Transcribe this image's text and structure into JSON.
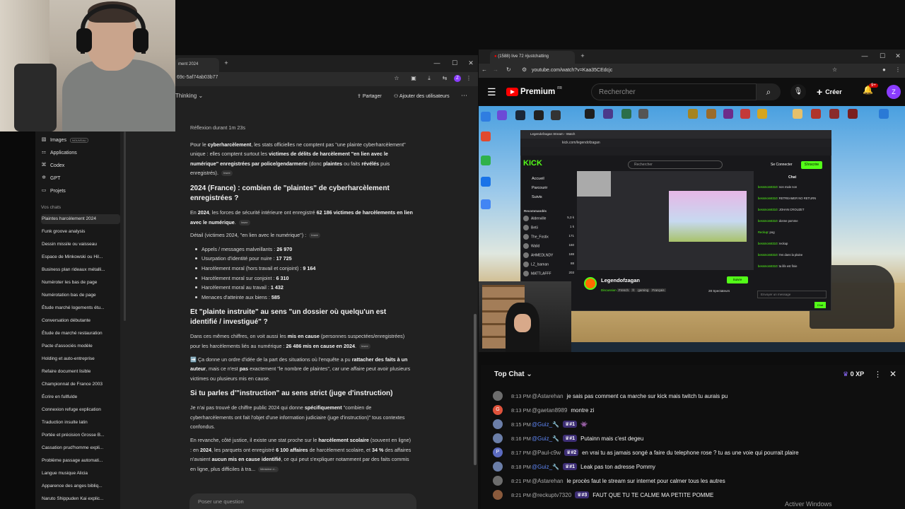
{
  "left_browser": {
    "tab_title": "ment 2024",
    "url": "69c-5af74ab03b77",
    "model_label": "Thinking",
    "share_label": "Partager",
    "add_users_label": "Ajouter des utilisateurs",
    "composer_placeholder": "Poser une question"
  },
  "sidebar": {
    "nav": [
      {
        "label": "Images",
        "badge": "NOUVEAU",
        "icon": "image-icon"
      },
      {
        "label": "Applications",
        "icon": "apps-icon"
      },
      {
        "label": "Codex",
        "icon": "code-icon"
      },
      {
        "label": "GPT",
        "icon": "gpt-icon"
      },
      {
        "label": "Projets",
        "icon": "folder-icon"
      }
    ],
    "chats_title": "Vos chats",
    "chats": [
      "Plaintes harcèlement 2024",
      "Funk groove analysis",
      "Dessin missile ou vaisseau",
      "Espace de Minkowski ou Hil...",
      "Business plan rideaux métalli...",
      "Numéroter les bas de page",
      "Numérotation bas de page",
      "Étude marché logements étu...",
      "Conversation débutante",
      "Étude de marché restauration",
      "Pacte d'associés modèle",
      "Holding et auto-entreprise",
      "Refaire document lisible",
      "Championnat de France 2003",
      "Écrire en fullfulde",
      "Connexion refuge explication",
      "Traduction insulte latin",
      "Portée et précision Grosse B...",
      "Cassation prud'homme expli...",
      "Problème passage automati...",
      "Langue musique Alicia",
      "Apparence des anges bibliq...",
      "Naruto Shippuden Kai explic..."
    ]
  },
  "answer": {
    "reflexion": "Réflexion durant 1m 23s",
    "src_label": "Insee",
    "src_label2": "Ministère d...",
    "p1_a": "Pour le ",
    "p1_b": "cyberharcèlement",
    "p1_c": ", les stats officielles ne comptent pas \"une plainte cyberharcèlement\" unique : elles comptent surtout les ",
    "p1_d": "victimes de délits de harcèlement \"en lien avec le numérique\" enregistrées par police/gendarmerie",
    "p1_e": " (donc ",
    "p1_f": "plaintes",
    "p1_g": " ou faits ",
    "p1_h": "révélés",
    "p1_i": " puis enregistrés).",
    "h1": "2024 (France) : combien de \"plaintes\" de cyberharcèlement enregistrées ?",
    "p2_a": "En ",
    "p2_b": "2024",
    "p2_c": ", les forces de sécurité intérieure ont enregistré ",
    "p2_d": "62 186 victimes de harcèlements en lien avec le numérique",
    "p2_e": ".",
    "detail_label": "Détail (victimes 2024, \"en lien avec le numérique\") :",
    "list": [
      {
        "label": "Appels / messages malveillants : ",
        "value": "26 970"
      },
      {
        "label": "Usurpation d'identité pour nuire : ",
        "value": "17 725"
      },
      {
        "label": "Harcèlement moral (hors travail et conjoint) : ",
        "value": "9 164"
      },
      {
        "label": "Harcèlement moral sur conjoint : ",
        "value": "6 310"
      },
      {
        "label": "Harcèlement moral au travail : ",
        "value": "1 432"
      },
      {
        "label": "Menaces d'atteinte aux biens : ",
        "value": "585"
      }
    ],
    "h2": "Et \"plainte instruite\" au sens \"un dossier où quelqu'un est identifié / investigué\" ?",
    "p3_a": "Dans ces mêmes chiffres, on voit aussi les ",
    "p3_b": "mis en cause",
    "p3_c": " (personnes suspectées/enregistrées) pour les harcèlements liés au numérique : ",
    "p3_d": "26 486 mis en cause en 2024",
    "p3_e": ".",
    "p4_a": "➡️ Ça donne un ordre d'idée de la part des situations où l'enquête a pu ",
    "p4_b": "rattacher des faits à un auteur",
    "p4_c": ", mais ce n'est ",
    "p4_d": "pas",
    "p4_e": " exactement \"le nombre de plaintes\", car une affaire peut avoir plusieurs victimes ou plusieurs mis en cause.",
    "h3": "Si tu parles d'\"instruction\" au sens strict (juge d'instruction)",
    "p5_a": "Je n'ai pas trouvé de chiffre public 2024 qui donne ",
    "p5_b": "spécifiquement",
    "p5_c": " \"combien de cyberharcèlements ont fait l'objet d'une information judiciaire (juge d'instruction)\" tous contextes confondus.",
    "p6_a": "En revanche, côté justice, il existe une stat proche sur le ",
    "p6_b": "harcèlement scolaire",
    "p6_c": " (souvent en ligne) : en ",
    "p6_d": "2024",
    "p6_e": ", les parquets ont enregistré ",
    "p6_f": "6 100 affaires",
    "p6_g": " de harcèlement scolaire, et ",
    "p6_h": "34 %",
    "p6_i": " des affaires n'avaient ",
    "p6_j": "aucun mis en cause identifié",
    "p6_k": ", ce qui peut s'expliquer notamment par des faits commis en ligne, plus difficiles à tra..."
  },
  "right_browser": {
    "tab_title": "(1588) live 72 #justchatting",
    "url": "youtube.com/watch?v=Kaa35CEdcjc"
  },
  "youtube": {
    "logo": "Premium",
    "region": "FR",
    "search_placeholder": "Rechercher",
    "create_label": "Créer",
    "notif_count": "9+",
    "avatar_letter": "Z"
  },
  "kick": {
    "tab_title": "Legendofzagan Stream - Watch",
    "url": "kick.com/legendofzagan",
    "logo": "KICK",
    "search_placeholder": "Rechercher",
    "connect": "Se Connecter",
    "signup": "S'inscrire",
    "nav": [
      "Accueil",
      "Parcourir",
      "Suivis"
    ],
    "reco_title": "Recommandés",
    "channels": [
      {
        "name": "Aldenville",
        "sub": "Fortnite",
        "v": "5,3 k"
      },
      {
        "name": "Betii",
        "sub": "Discussion",
        "v": "1 k"
      },
      {
        "name": "The_Fostix",
        "sub": "Grand Theft Auto V RP",
        "v": "171"
      },
      {
        "name": "Walid",
        "sub": "Discussion",
        "v": "160"
      },
      {
        "name": "AHMEDLNDY",
        "sub": "Discussion",
        "v": "188"
      },
      {
        "name": "LZ_Isaman",
        "sub": "Grand Theft Auto V RP",
        "v": "88"
      },
      {
        "name": "MATTLAFFF",
        "sub": "",
        "v": "203"
      }
    ],
    "chat_title": "Chat",
    "msgs": [
      {
        "u": "bessmom8310",
        "t": "non male non"
      },
      {
        "u": "bessmom8310",
        "t": "RETREAMER NO RETURN"
      },
      {
        "u": "bessmom8310",
        "t": "JOHAN CROUZET"
      },
      {
        "u": "bessmom8310",
        "t": "donne pomme"
      },
      {
        "u": "Reckup",
        "t": "pog"
      },
      {
        "u": "bessmom8310",
        "t": "reckup"
      },
      {
        "u": "bessmom8310",
        "t": "t'es dans la plaine"
      },
      {
        "u": "bessmom8310",
        "t": "ta life est finie"
      }
    ],
    "channel_name": "Legendofzagan",
    "category": "Discussion",
    "tags": [
      "French",
      "fr",
      "gaming",
      "Français"
    ],
    "follow": "Suivre",
    "viewers": "28 Spectateurs",
    "send_placeholder": "Envoyer un message",
    "chat_button": "Chat"
  },
  "chat": {
    "title": "Top Chat",
    "xp": "0 XP",
    "messages": [
      {
        "time": "8:13 PM",
        "user": "@Astarehan",
        "text": "je sais pas comment ca marche sur kick mais twitch tu aurais pu",
        "badge": "",
        "mod": false,
        "av": "",
        "avcolor": "#6d6d6d"
      },
      {
        "time": "8:13 PM",
        "user": "@gaetan8989",
        "text": "montre zi",
        "badge": "",
        "mod": false,
        "av": "G",
        "avcolor": "#e0533c"
      },
      {
        "time": "8:15 PM",
        "user": "@Guiz_🔧",
        "text": "👾",
        "badge": "#1",
        "mod": true,
        "av": "",
        "avcolor": "#6b7ea8"
      },
      {
        "time": "8:16 PM",
        "user": "@Guiz_🔧",
        "text": "Putainn mais c'est degeu",
        "badge": "#1",
        "mod": true,
        "av": "",
        "avcolor": "#6b7ea8"
      },
      {
        "time": "8:17 PM",
        "user": "@Paul-c9w",
        "text": "en vrai tu as jamais songé a faire du telephone rose ? tu as une voie qui pourrait plaire",
        "badge": "#2",
        "mod": false,
        "av": "P",
        "avcolor": "#5c6bc0"
      },
      {
        "time": "8:18 PM",
        "user": "@Guiz_🔧",
        "text": "Leak pas ton adresse Pommy",
        "badge": "#1",
        "mod": true,
        "av": "",
        "avcolor": "#6b7ea8"
      },
      {
        "time": "8:21 PM",
        "user": "@Astarehan",
        "text": "le procès faut le stream sur internet pour calmer tous les autres",
        "badge": "",
        "mod": false,
        "av": "",
        "avcolor": "#6d6d6d"
      },
      {
        "time": "8:21 PM",
        "user": "@reckuptv7320",
        "text": "FAUT QUE TU TE CALME MA PETITE POMME",
        "badge": "#3",
        "mod": false,
        "av": "",
        "avcolor": "#8a5a3c"
      }
    ]
  },
  "os": {
    "watermark": "Activer Windows"
  },
  "colors": {
    "yt_red": "#ff0000",
    "kick_green": "#53fc18",
    "mod_blue": "#5e84f1",
    "badge_purple": "#3d2e75"
  }
}
